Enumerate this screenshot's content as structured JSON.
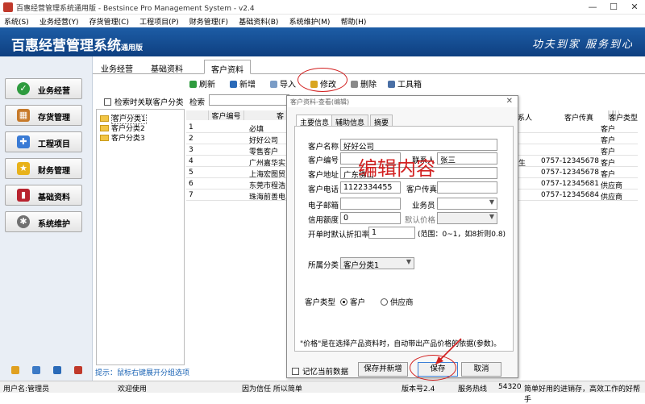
{
  "window": {
    "title": "百惠经营管理系统通用版 - Bestsince Pro Management System - v2.4",
    "controls": [
      "—",
      "☐",
      "✕"
    ]
  },
  "menu": [
    "系统(S)",
    "业务经营(Y)",
    "存货管理(C)",
    "工程项目(P)",
    "财务管理(F)",
    "基础资料(B)",
    "系统维护(M)",
    "帮助(H)"
  ],
  "banner": {
    "brand": "百惠经营管理系统",
    "edition": "通用版",
    "slogan": "功夫到家  服务到心"
  },
  "sidebar": {
    "items": [
      {
        "label": "业务经营",
        "icon": "check-icon",
        "color": "#2e9b3e"
      },
      {
        "label": "存货管理",
        "icon": "boxes-icon",
        "color": "#c77a2a"
      },
      {
        "label": "工程项目",
        "icon": "puzzle-icon",
        "color": "#3a7bd5"
      },
      {
        "label": "财务管理",
        "icon": "star-icon",
        "color": "#e8b21a"
      },
      {
        "label": "基础资料",
        "icon": "book-icon",
        "color": "#b8232f"
      },
      {
        "label": "系统维护",
        "icon": "gear-icon",
        "color": "#707070"
      }
    ]
  },
  "tabs": [
    "业务经营",
    "基础资料",
    "客户资料"
  ],
  "toolbar": {
    "refresh": "刷新",
    "add": "新增",
    "import": "导入",
    "edit": "修改",
    "delete": "删除",
    "tools": "工具箱"
  },
  "filter": {
    "checkbox_label": "检索时关联客户分类",
    "search_label": "检索"
  },
  "tree": [
    "客户分类1",
    "客户分类2",
    "客户分类3"
  ],
  "grid": {
    "columns": [
      "客户编号",
      "客",
      "系人",
      "客户传真",
      "客户类型"
    ],
    "rows": [
      {
        "no": "1",
        "name": "必填",
        "contact": "",
        "fax": "",
        "type": "客户"
      },
      {
        "no": "2",
        "name": "好好公司",
        "contact": "",
        "fax": "",
        "type": "客户"
      },
      {
        "no": "3",
        "name": "零售客户",
        "contact": "",
        "fax": "",
        "type": "客户"
      },
      {
        "no": "4",
        "name": "广州嘉华实",
        "contact": "生",
        "fax": "0757-12345678",
        "type": "客户"
      },
      {
        "no": "5",
        "name": "上海宏图贸",
        "contact": "",
        "fax": "0757-12345678",
        "type": "客户"
      },
      {
        "no": "6",
        "name": "东莞市程浩",
        "contact": "",
        "fax": "0757-12345681",
        "type": "供应商"
      },
      {
        "no": "7",
        "name": "珠海前善电",
        "contact": "",
        "fax": "0757-12345684",
        "type": "供应商"
      }
    ]
  },
  "hint": "提示：鼠标右键展开分组选项",
  "statusbar": {
    "user": "用户名:管理员",
    "welcome": "欢迎使用",
    "motto": "因为信任 所以简单",
    "version": "版本号2.4",
    "service": "服务热线",
    "phone": "54320",
    "tagline": "简单好用的进销存，高效工作的好帮手"
  },
  "dialog": {
    "title": "客户资料-查看(编辑)",
    "tabs": [
      "主要信息",
      "辅助信息",
      "摘要"
    ],
    "fields": {
      "name_label": "客户名称",
      "name_value": "好好公司",
      "code_label": "客户编号",
      "code_value": "",
      "contact_label": "联系人",
      "contact_value": "张三",
      "address_label": "客户地址",
      "address_value": "广东佛山",
      "phone_label": "客户电话",
      "phone_value": "1122334455",
      "fax_label": "客户传真",
      "fax_value": "",
      "email_label": "电子邮箱",
      "email_value": "",
      "salesman_label": "业务员",
      "salesman_value": "",
      "credit_label": "信用额度",
      "credit_value": "0",
      "price_label": "默认价格",
      "price_value": "",
      "discount_label": "开单时默认折扣率",
      "discount_value": "1",
      "discount_hint": "(范围：0~1，如8折则0.8)",
      "category_label": "所属分类",
      "category_value": "客户分类1",
      "type_label": "客户类型",
      "type_customer": "客户",
      "type_supplier": "供应商",
      "note": "\"价格\"是在选择产品资料时，自动带出产品价格的依据(参数)。"
    },
    "overlay_text": "编辑内容",
    "remember_label": "记忆当前数据",
    "buttons": {
      "save_new": "保存并新增",
      "save": "保存",
      "cancel": "取消"
    }
  },
  "annotation_color": "#d21f1f"
}
